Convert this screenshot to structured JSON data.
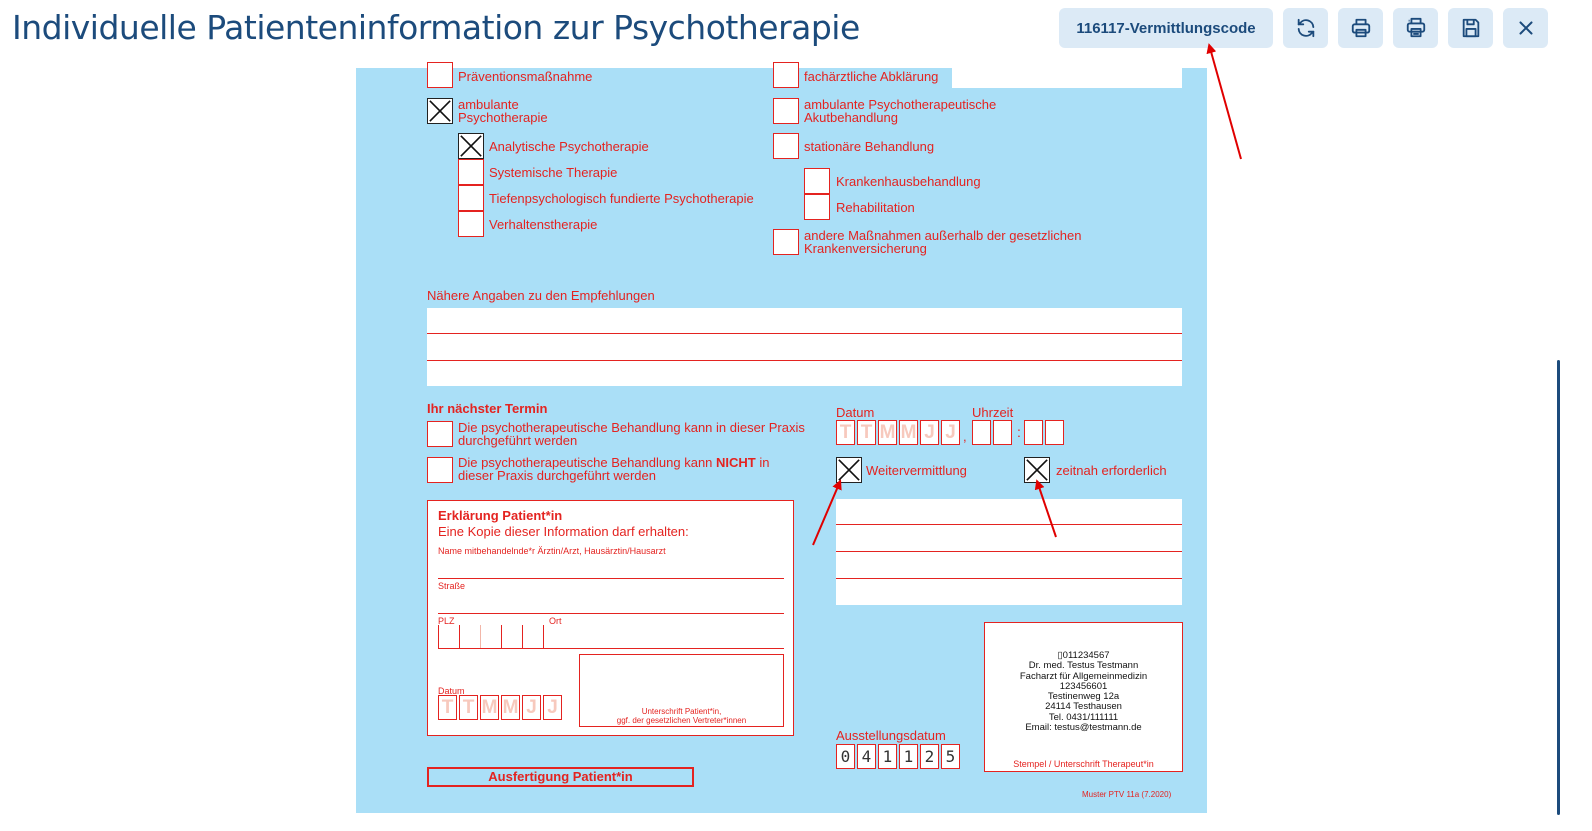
{
  "header": {
    "title": "Individuelle Patienteninformation zur Psychotherapie",
    "code_button": "116117-Vermittlungscode",
    "icons": [
      "refresh-icon",
      "print-icon",
      "print-multiple-icon",
      "save-icon",
      "close-icon"
    ]
  },
  "form": {
    "left_options": {
      "praevention": "Präventionsmaßnahme",
      "ambulante": "ambulante",
      "psychotherapie": "Psychotherapie",
      "analytische": "Analytische Psychotherapie",
      "systemische": "Systemische Therapie",
      "tiefen": "Tiefenpsychologisch fundierte Psychotherapie",
      "verhaltens": "Verhaltenstherapie"
    },
    "right_options": {
      "fachaerztlich": "fachärztliche Abklärung",
      "akut_1": "ambulante Psychotherapeutische",
      "akut_2": "Akutbehandlung",
      "stationaer": "stationäre Behandlung",
      "krankenhaus": "Krankenhausbehandlung",
      "reha": "Rehabilitation",
      "andere_1": "andere Maßnahmen außerhalb der gesetzlichen",
      "andere_2": "Krankenversicherung"
    },
    "naehere_label": "Nähere Angaben zu den Empfehlungen",
    "termin": {
      "heading": "Ihr nächster Termin",
      "opt1_line1": "Die psychotherapeutische Behandlung kann in dieser Praxis",
      "opt1_line2": "durchgeführt werden",
      "opt2_pre": "Die psychotherapeutische Behandlung kann ",
      "opt2_bold": "NICHT",
      "opt2_post": " in",
      "opt2_line2": "dieser Praxis durchgeführt werden",
      "datum_label": "Datum",
      "uhrzeit_label": "Uhrzeit",
      "date_placeholders": [
        "T",
        "T",
        "M",
        "M",
        "J",
        "J"
      ],
      "dot": ",",
      "colon": ":",
      "weitervermittlung": "Weitervermittlung",
      "zeitnah": "zeitnah erforderlich"
    },
    "erklaerung": {
      "title": "Erklärung Patient*in",
      "subtitle": "Eine Kopie dieser Information darf erhalten:",
      "name_label": "Name mitbehandelnde*r Ärztin/Arzt, Hausärztin/Hausarzt",
      "strasse_label": "Straße",
      "plz_label": "PLZ",
      "ort_label": "Ort",
      "datum_label": "Datum",
      "date_placeholders": [
        "T",
        "T",
        "M",
        "M",
        "J",
        "J"
      ],
      "signature_line1": "Unterschrift Patient*in,",
      "signature_line2": "ggf. der gesetzlichen Vertreter*innen"
    },
    "stamp": {
      "lines": [
        "▯011234567",
        "Dr. med. Testus Testmann",
        "Facharzt für Allgemeinmedizin",
        "123456601",
        "Testinenweg 12a",
        "24114 Testhausen",
        "Tel. 0431/111111",
        "Email: testus@testmann.de"
      ],
      "footer": "Stempel / Unterschrift Therapeut*in"
    },
    "ausstellung_label": "Ausstellungsdatum",
    "ausstellung_digits": [
      "0",
      "4",
      "1",
      "1",
      "2",
      "5"
    ],
    "ausfertigung": "Ausfertigung Patient*in",
    "muster": "Muster  PTV 11a (7.2020)"
  },
  "colors": {
    "accent": "#1c4b7c",
    "form_bg": "#aadff7",
    "form_red": "#e42320",
    "button_bg": "#dceaf6"
  }
}
